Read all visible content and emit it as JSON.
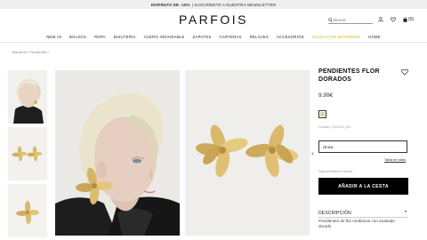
{
  "promo": {
    "bold": "DISFRUTA DE -10%",
    "text": "| SUSCRÍBETE A NUESTRA NEWSLETTER"
  },
  "brand": {
    "logo": "PARFOIS"
  },
  "search": {
    "placeholder": "Buscar"
  },
  "cart": {
    "count": "(0)"
  },
  "nav": {
    "items": [
      "NEW IN",
      "BOLSOS",
      "ROPA",
      "BISUTERÍA",
      "ACERO INOXIDABLE",
      "ZAPATOS",
      "CARTERAS",
      "RELOJES",
      "ACCESORIOS",
      "COLECCIÓN MOONRISE",
      "HOME"
    ],
    "highlight_color": "#c9b21c"
  },
  "breadcrumb": "Bisutería  /  Pendientes  /",
  "product": {
    "title": "PENDIENTES FLOR DORADOS",
    "price": "9.99€",
    "color_swatch": "#dcd2b0",
    "reference": "Dorado | 213141_DO",
    "size_value": "Única",
    "size_table": "Tabla de tallas",
    "availability": "Disponibilidad en tienda",
    "add_button": "AÑADIR A LA CESTA",
    "description_heading": "DESCRIPCIÓN",
    "description_toggle": "•",
    "description": "Pendientes de flor medianos con acabado dorado"
  },
  "icons": [
    "search-icon",
    "user-icon",
    "heart-icon",
    "bag-icon",
    "chevron-right-icon"
  ]
}
